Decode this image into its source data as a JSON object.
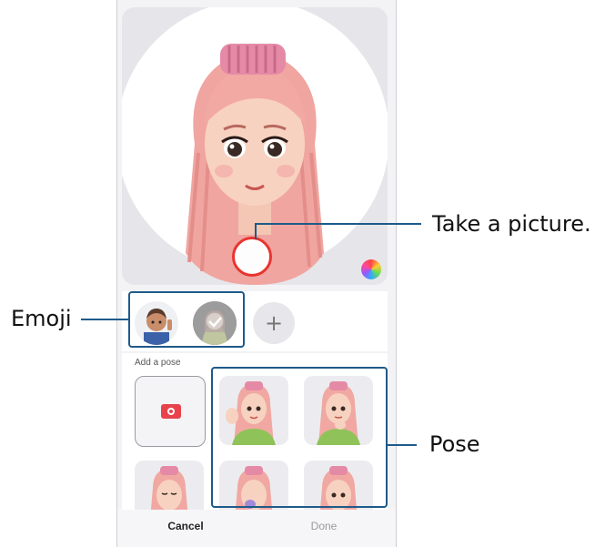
{
  "callouts": {
    "take_picture": "Take a picture.",
    "emoji": "Emoji",
    "pose": "Pose"
  },
  "add_pose": {
    "label": "Add a pose",
    "icon": "camera-icon"
  },
  "emoji_row": {
    "add_icon": "plus-icon",
    "add_glyph": "+"
  },
  "footer": {
    "cancel_label": "Cancel",
    "done_label": "Done"
  },
  "colors": {
    "accent_callout": "#1e5a8a",
    "shutter_ring": "#e8352f",
    "add_pose_icon": "#e8434d"
  }
}
